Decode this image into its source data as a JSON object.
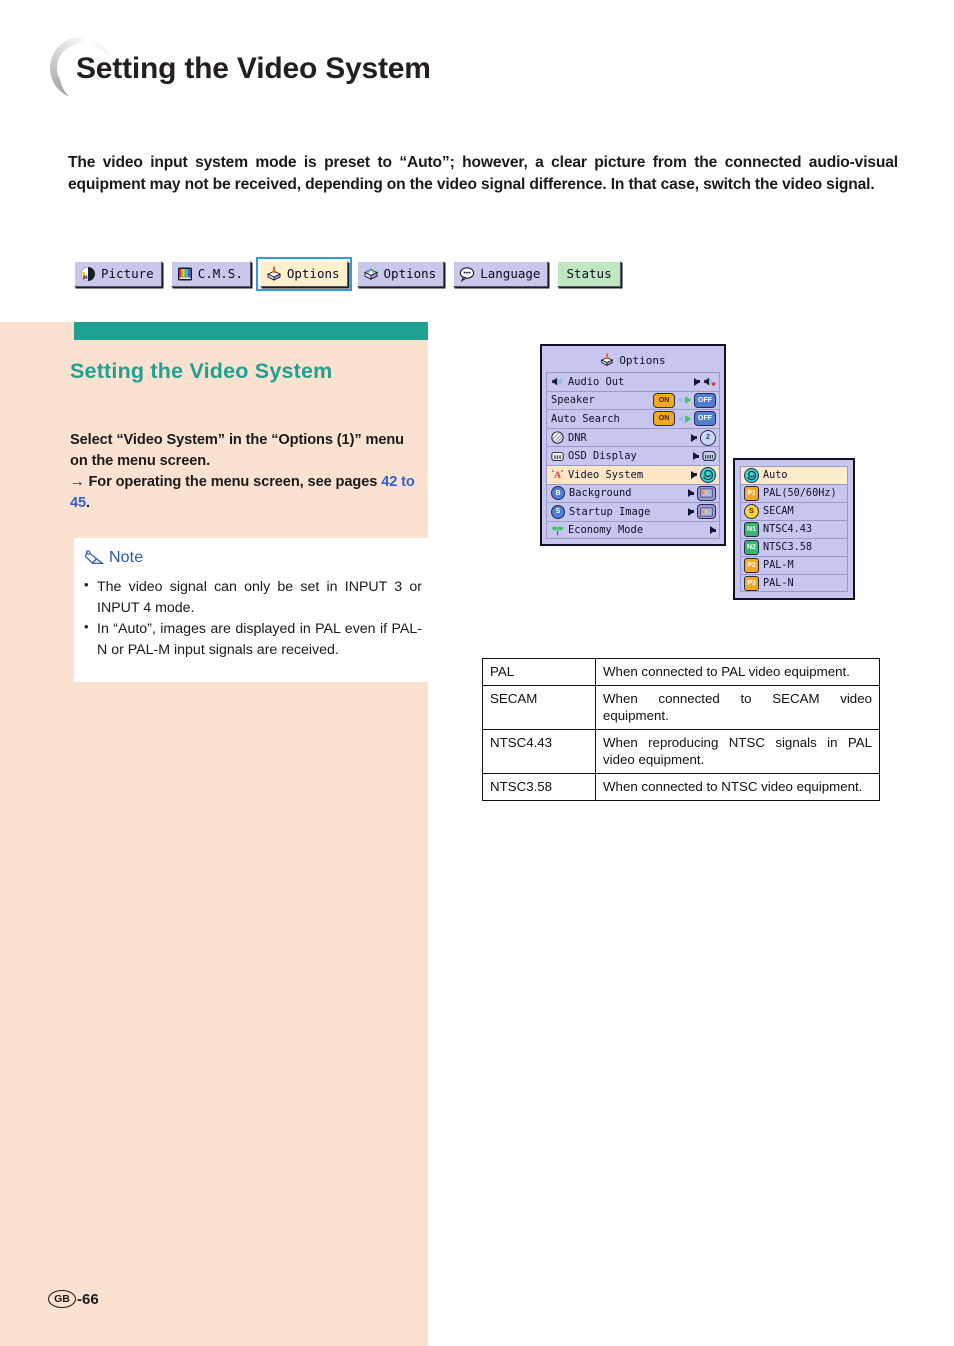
{
  "page": {
    "title": "Setting the Video System",
    "intro": "The video input system mode is preset to “Auto”; however, a clear picture from the connected audio-visual equipment may not be received, depending on the video signal difference. In that case, switch the video signal.",
    "footer_region": "GB",
    "footer_page": "-66"
  },
  "tabs": [
    {
      "label": "Picture",
      "icon": "picture-icon",
      "selected": false,
      "style": "normal"
    },
    {
      "label": "C.M.S.",
      "icon": "cms-icon",
      "selected": false,
      "style": "normal"
    },
    {
      "label": "Options",
      "icon": "options1-icon",
      "selected": true,
      "style": "normal"
    },
    {
      "label": "Options",
      "icon": "options2-icon",
      "selected": false,
      "style": "normal"
    },
    {
      "label": "Language",
      "icon": "language-icon",
      "selected": false,
      "style": "normal"
    },
    {
      "label": "Status",
      "icon": "none",
      "selected": false,
      "style": "status"
    }
  ],
  "section": {
    "heading": "Setting the Video System",
    "body_line1": "Select “Video System” in the “Options (1)” menu on the menu screen.",
    "body_arrow": "→",
    "body_line2_pre": " For operating the menu screen, see pages ",
    "body_pagelink": "42 to 45",
    "body_line2_post": "."
  },
  "note": {
    "title": "Note",
    "icon": "pencil-icon",
    "items": [
      "The video signal can only be set in INPUT 3 or INPUT 4 mode.",
      "In “Auto”, images are displayed in PAL even if PAL-N or PAL-M input signals are received."
    ]
  },
  "osd_menu": {
    "title": "Options",
    "title_icon": "options1-icon",
    "rows": [
      {
        "label": "Audio Out",
        "icon": "speaker-out-icon",
        "control": "arrow-value",
        "value_icon": "speaker-mute-icon",
        "highlight": false
      },
      {
        "label": "Speaker",
        "icon": "none",
        "control": "on-off",
        "on": "ON",
        "off": "OFF",
        "highlight": false
      },
      {
        "label": "Auto Search",
        "icon": "none",
        "control": "on-off",
        "on": "ON",
        "off": "OFF",
        "highlight": false
      },
      {
        "label": "DNR",
        "icon": "dnr-icon",
        "control": "arrow-value",
        "value_text": "2",
        "highlight": false
      },
      {
        "label": "OSD Display",
        "icon": "osd-icon",
        "control": "arrow-value",
        "value_icon": "osd-icon",
        "highlight": false
      },
      {
        "label": "Video System",
        "icon": "video-system-icon",
        "control": "arrow-value",
        "value_icon": "auto-icon",
        "highlight": true
      },
      {
        "label": "Background",
        "icon": "background-icon",
        "control": "arrow-value",
        "value_icon": "image-icon",
        "highlight": false
      },
      {
        "label": "Startup Image",
        "icon": "startup-icon",
        "control": "arrow-value",
        "value_icon": "image-icon",
        "highlight": false
      },
      {
        "label": "Economy Mode",
        "icon": "economy-icon",
        "control": "arrow-only",
        "highlight": false
      }
    ]
  },
  "osd_submenu": {
    "items": [
      {
        "label": "Auto",
        "badge": "A",
        "badge_color": "teal",
        "badge_shape": "round",
        "highlight": true
      },
      {
        "label": "PAL(50/60Hz)",
        "badge": "P1",
        "badge_color": "orange",
        "badge_shape": "square",
        "highlight": false
      },
      {
        "label": "SECAM",
        "badge": "S",
        "badge_color": "yellow",
        "badge_shape": "round",
        "highlight": false
      },
      {
        "label": "NTSC4.43",
        "badge": "N1",
        "badge_color": "green",
        "badge_shape": "square",
        "highlight": false
      },
      {
        "label": "NTSC3.58",
        "badge": "N2",
        "badge_color": "green",
        "badge_shape": "square",
        "highlight": false
      },
      {
        "label": "PAL-M",
        "badge": "P2",
        "badge_color": "orange",
        "badge_shape": "square",
        "highlight": false
      },
      {
        "label": "PAL-N",
        "badge": "P3",
        "badge_color": "orange",
        "badge_shape": "square",
        "highlight": false
      }
    ]
  },
  "table": {
    "rows": [
      {
        "term": "PAL",
        "desc": "When connected to PAL video equipment.",
        "tight": true
      },
      {
        "term": "SECAM",
        "desc": "When connected to SECAM video equipment.",
        "tight": false
      },
      {
        "term": "NTSC4.43",
        "desc": "When reproducing NTSC signals in PAL video equipment.",
        "tight": false
      },
      {
        "term": "NTSC3.58",
        "desc": "When connected to NTSC video equipment.",
        "tight": true
      }
    ]
  },
  "colors": {
    "teal": "#1ea191",
    "peach": "#fbe1d0",
    "link_blue": "#2f5fd0",
    "note_blue": "#2d56b5",
    "osd_lavender": "#c6c6ee",
    "osd_highlight": "#fce6c3"
  }
}
